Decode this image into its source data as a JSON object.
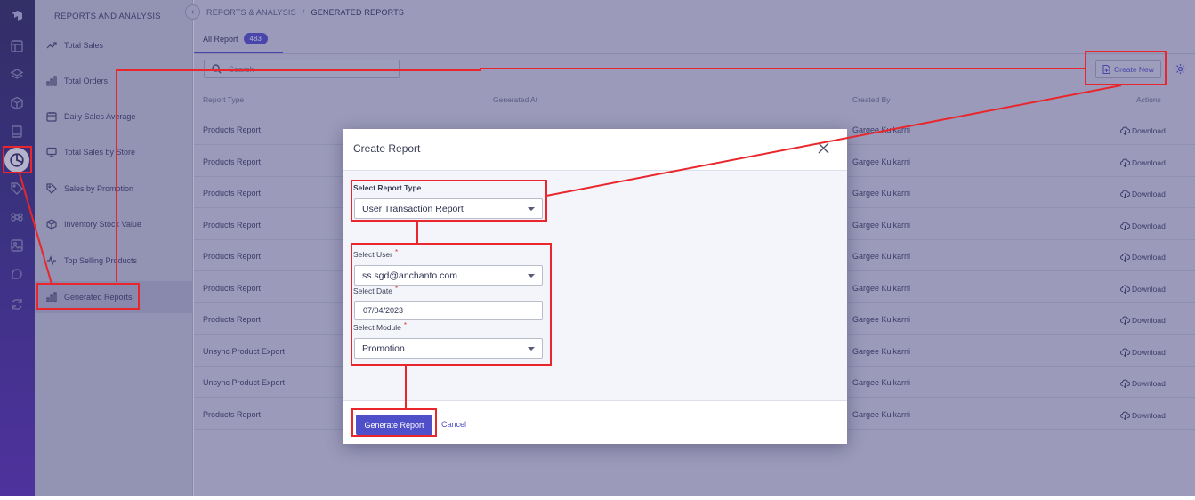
{
  "rail": {
    "icons": [
      "logo-icon",
      "layout-icon",
      "layers-icon",
      "cube-icon",
      "book-icon",
      "reports-pie-icon",
      "tag-icon",
      "command-icon",
      "image-icon",
      "chat-icon",
      "sync-icon"
    ]
  },
  "sidebar": {
    "title": "REPORTS AND ANALYSIS",
    "items": [
      {
        "label": "Total Sales",
        "icon": "trend-icon"
      },
      {
        "label": "Total Orders",
        "icon": "bar-chart-icon"
      },
      {
        "label": "Daily Sales Average",
        "icon": "calendar-icon"
      },
      {
        "label": "Total Sales by Store",
        "icon": "monitor-icon"
      },
      {
        "label": "Sales by Promotion",
        "icon": "tag-icon"
      },
      {
        "label": "Inventory Stock Value",
        "icon": "box-icon"
      },
      {
        "label": "Top Selling Products",
        "icon": "pulse-icon"
      },
      {
        "label": "Generated Reports",
        "icon": "bar-chart-icon",
        "active": true
      }
    ]
  },
  "breadcrumb": {
    "root": "REPORTS & ANALYSIS",
    "sep": "/",
    "current": "GENERATED REPORTS"
  },
  "tabs": [
    {
      "label": "All Report",
      "count": "483"
    }
  ],
  "search": {
    "placeholder": "Search"
  },
  "toolbar": {
    "create_label": "Create New"
  },
  "table": {
    "headers": {
      "type": "Report Type",
      "generated": "Generated At",
      "created_by": "Created By",
      "actions": "Actions"
    },
    "rows": [
      {
        "type": "Products Report",
        "created_by": "Gargee Kulkarni",
        "action": "Download"
      },
      {
        "type": "Products Report",
        "created_by": "Gargee Kulkarni",
        "action": "Download"
      },
      {
        "type": "Products Report",
        "created_by": "Gargee Kulkarni",
        "action": "Download"
      },
      {
        "type": "Products Report",
        "created_by": "Gargee Kulkarni",
        "action": "Download"
      },
      {
        "type": "Products Report",
        "created_by": "Gargee Kulkarni",
        "action": "Download"
      },
      {
        "type": "Products Report",
        "created_by": "Gargee Kulkarni",
        "action": "Download"
      },
      {
        "type": "Products Report",
        "created_by": "Gargee Kulkarni",
        "action": "Download"
      },
      {
        "type": "Unsync Product Export",
        "created_by": "Gargee Kulkarni",
        "action": "Download"
      },
      {
        "type": "Unsync Product Export",
        "created_by": "Gargee Kulkarni",
        "action": "Download"
      },
      {
        "type": "Products Report",
        "created_by": "Gargee Kulkarni",
        "action": "Download"
      }
    ]
  },
  "modal": {
    "title": "Create Report",
    "report_type_label": "Select Report Type",
    "report_type_value": "User Transaction Report",
    "user_label": "Select User",
    "user_value": "ss.sgd@anchanto.com",
    "date_label": "Select Date",
    "date_value": "07/04/2023",
    "module_label": "Select Module",
    "module_value": "Promotion",
    "required_mark": "*",
    "generate_label": "Generate Report",
    "cancel_label": "Cancel"
  },
  "colors": {
    "accent": "#4f4fc9",
    "annotation": "#e8262b",
    "rail_top": "#2e2a5c",
    "rail_bottom": "#5a2fb4"
  }
}
